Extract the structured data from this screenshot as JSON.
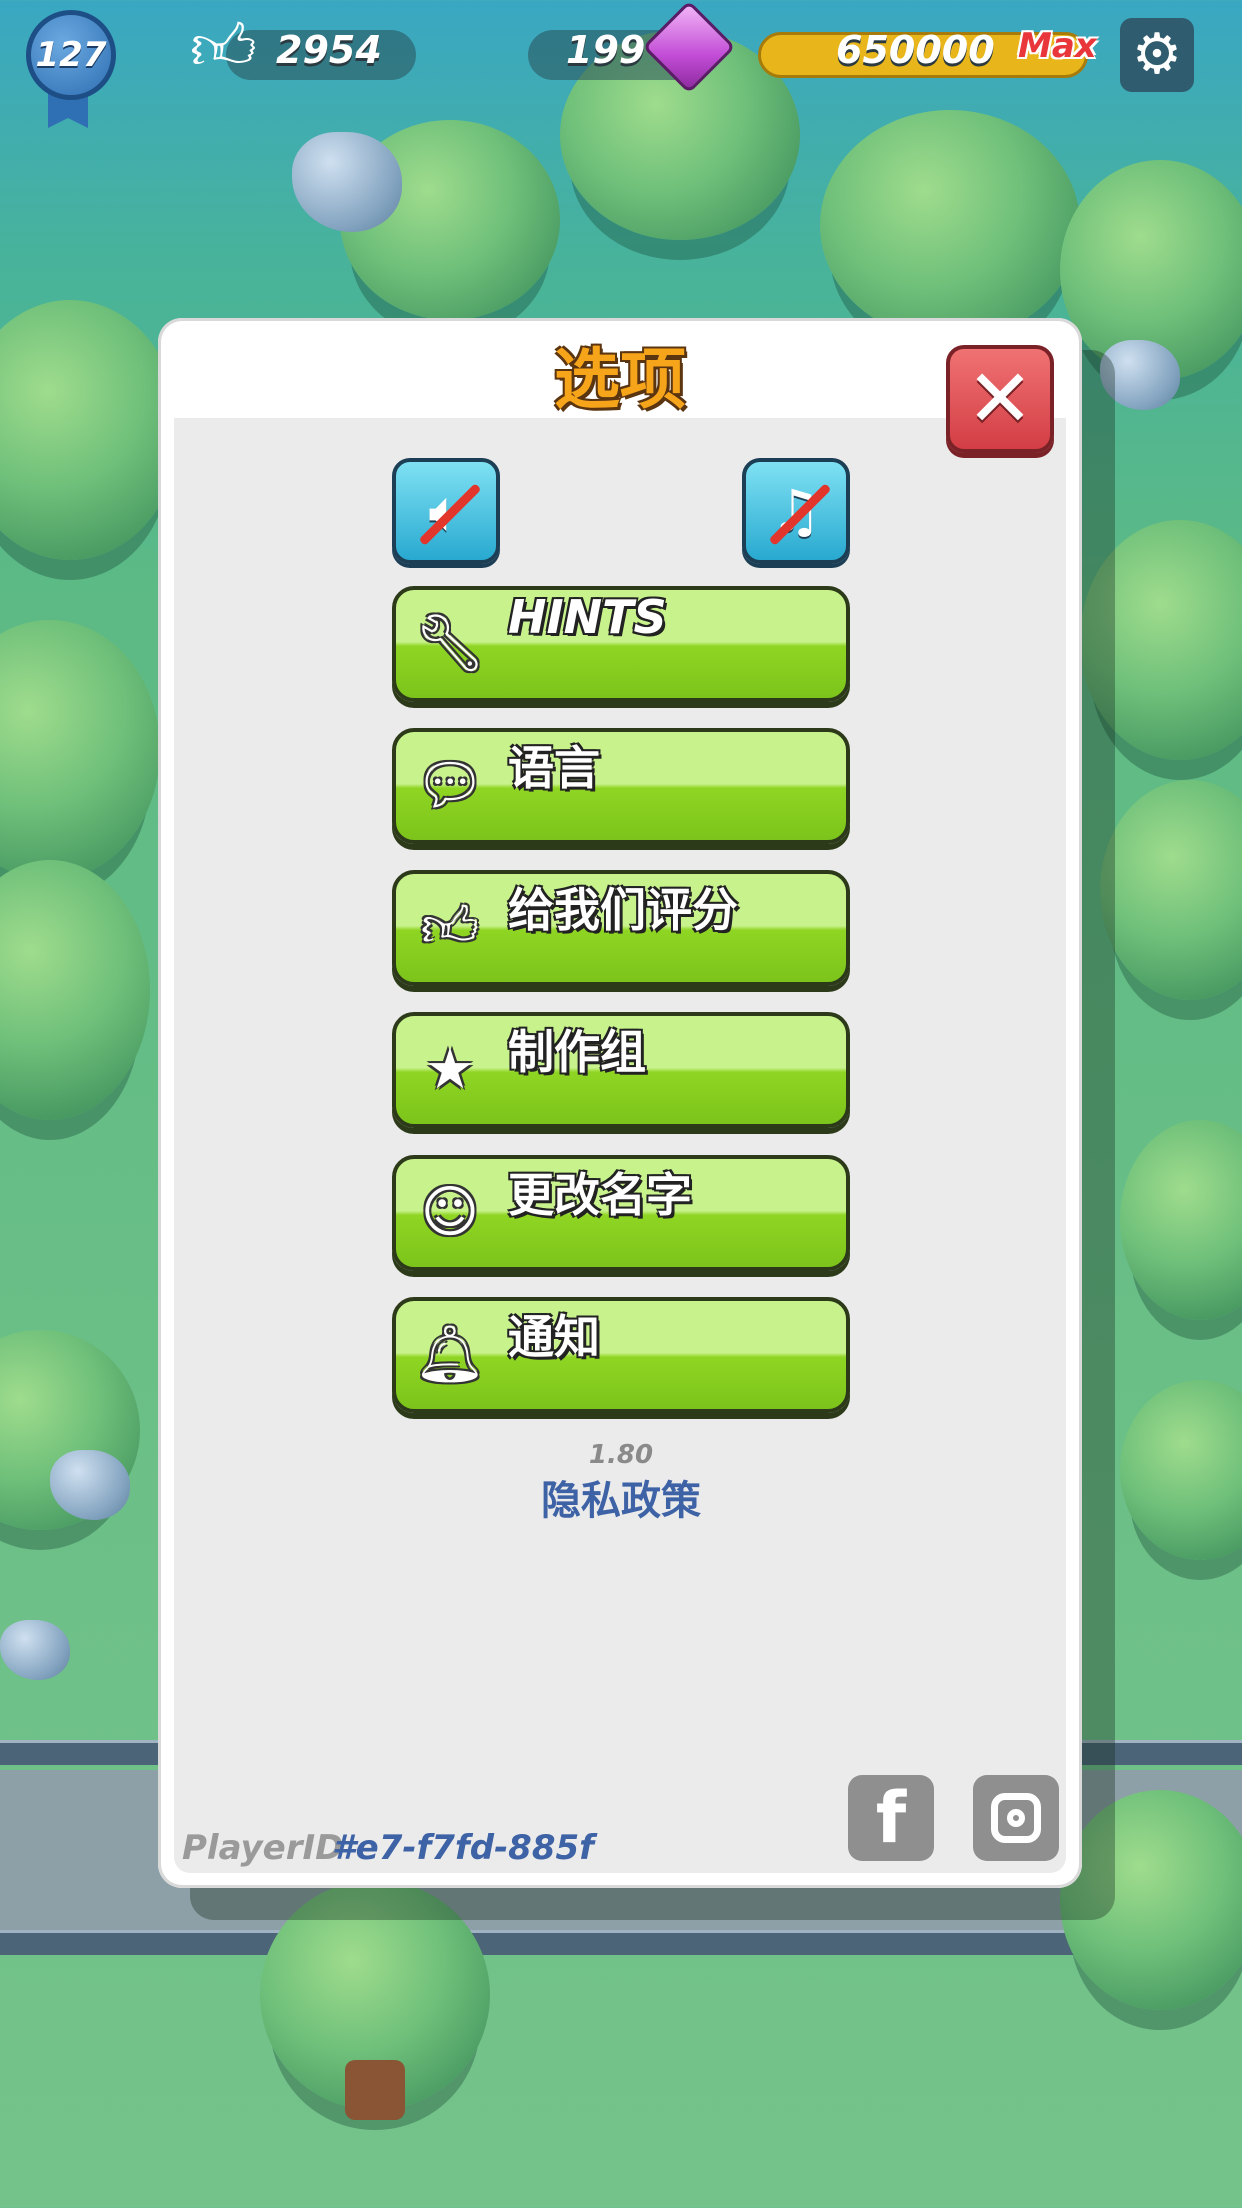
{
  "hud": {
    "level": "127",
    "likes": "2954",
    "gems": "199",
    "coins": "650000",
    "coins_cap": "Max"
  },
  "dialog": {
    "title": "选项",
    "menu": [
      {
        "label": "HINTS",
        "icon": "wrench-icon"
      },
      {
        "label": "语言",
        "icon": "chat-bubble-icon"
      },
      {
        "label": "给我们评分",
        "icon": "thumbs-up-icon"
      },
      {
        "label": "制作组",
        "icon": "star-icon"
      },
      {
        "label": "更改名字",
        "icon": "name-card-icon"
      },
      {
        "label": "通知",
        "icon": "bell-icon"
      }
    ],
    "version": "1.80",
    "privacy": "隐私政策",
    "player_label": "PlayerID",
    "player_id": "#e7-f7fd-885f"
  },
  "colors": {
    "button_green": "#8fd523",
    "title_orange": "#f6a51b",
    "close_red": "#d33e45",
    "link_blue": "#3d62a5"
  }
}
